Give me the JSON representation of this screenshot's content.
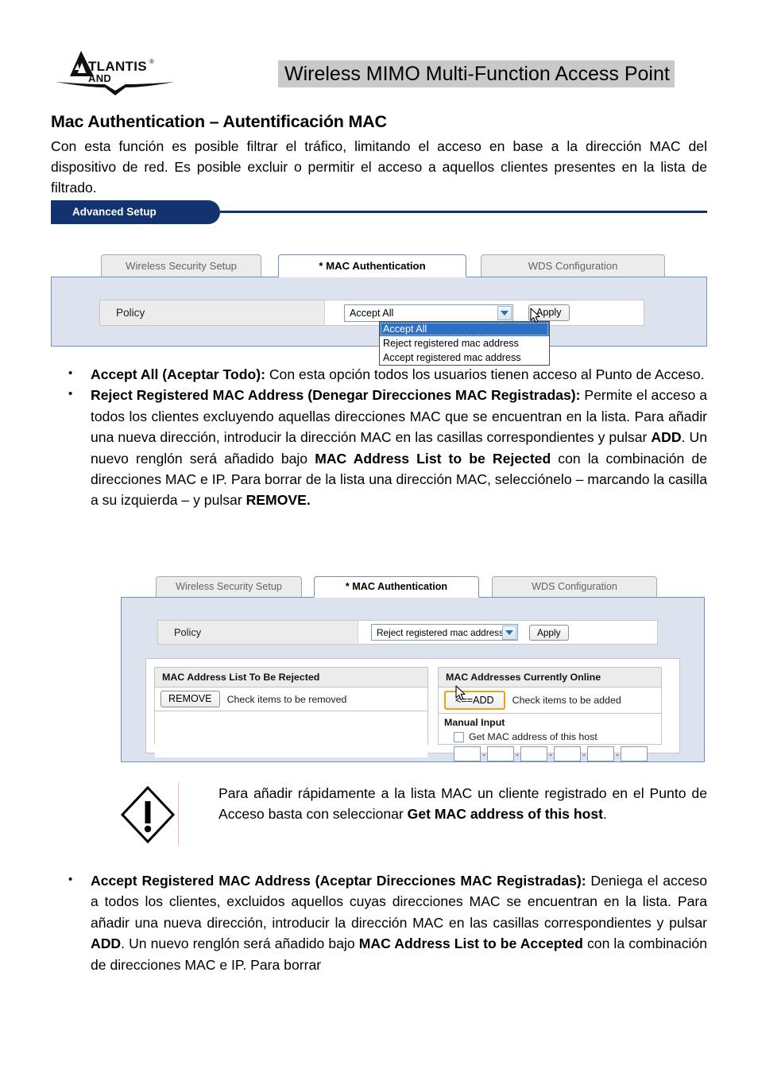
{
  "header": {
    "logo_main": "TLANTIS",
    "logo_reg": "®",
    "logo_sub": "AND",
    "title": "Wireless MIMO Multi-Function Access Point"
  },
  "document": {
    "section_title": "Mac Authentication – Autentificación MAC",
    "intro": "Con esta función es posible filtrar el tráfico, limitando el acceso en base a la dirección MAC del dispositivo de red. Es posible excluir o permitir el acceso a aquellos clientes presentes en la lista de filtrado.",
    "bullets": [
      {
        "lead": "Accept All (Aceptar Todo):",
        "rest": " Con esta opción todos los usuarios tienen acceso al Punto de Acceso."
      },
      {
        "lead": "Reject Registered MAC Address (Denegar Direcciones MAC Registradas):",
        "rest_1": " Permite el acceso a todos los clientes excluyendo aquellas direcciones MAC que se encuentran en la lista. Para añadir una nueva dirección, introducir la dirección MAC en las casillas correspondientes y pulsar ",
        "bold_2": "ADD",
        "rest_2": ". Un nuevo renglón será añadido bajo ",
        "bold_3": "MAC Address List to be Rejected",
        "rest_3": " con la combinación de direcciones MAC e IP. Para borrar de la lista una dirección MAC, selecciónelo – marcando la casilla a su izquierda – y pulsar ",
        "bold_4": "REMOVE."
      },
      {
        "lead": "Accept Registered MAC Address (Aceptar Direcciones MAC Registradas):",
        "rest_1": " Deniega el acceso a todos los clientes, excluidos aquellos cuyas direcciones MAC se encuentran en la lista. Para añadir una nueva dirección, introducir la dirección MAC en las casillas correspondientes y pulsar ",
        "bold_2": "ADD",
        "rest_2": ". Un nuevo renglón será añadido bajo ",
        "bold_3": "MAC Address List to be Accepted",
        "rest_3": " con la combinación de direcciones MAC e IP. Para borrar"
      }
    ]
  },
  "note": {
    "icon": "warning-exclamation-diamond-icon",
    "text_1": "Para añadir rápidamente a la lista MAC un cliente registrado en el Punto de Acceso basta con seleccionar ",
    "bold": "Get MAC address of this host",
    "text_2": "."
  },
  "screenshot1": {
    "banner": "Advanced Setup",
    "tabs": [
      {
        "label": "Wireless Security Setup",
        "active": false
      },
      {
        "label": "* MAC Authentication",
        "active": true
      },
      {
        "label": "WDS Configuration",
        "active": false
      }
    ],
    "policy_label": "Policy",
    "policy_value": "Accept All",
    "apply_label": "Apply",
    "dropdown_options": [
      "Accept All",
      "Reject registered mac address",
      "Accept registered mac address"
    ],
    "dropdown_selected_index": 0
  },
  "screenshot2": {
    "tabs": [
      {
        "label": "Wireless Security Setup",
        "active": false
      },
      {
        "label": "* MAC Authentication",
        "active": true
      },
      {
        "label": "WDS Configuration",
        "active": false
      }
    ],
    "policy_label": "Policy",
    "policy_value": "Reject registered mac address",
    "apply_label": "Apply",
    "left_panel": {
      "header": "MAC Address List To Be Rejected",
      "button": "REMOVE",
      "hint": "Check items to be removed"
    },
    "right_panel": {
      "header": "MAC Addresses Currently Online",
      "button": "<==ADD",
      "hint": "Check items to be added",
      "manual_title": "Manual Input",
      "checkbox_label": "Get MAC address of this host",
      "checkbox_checked": false,
      "mac_octets": [
        "",
        "",
        "",
        "",
        "",
        ""
      ],
      "octet_separator": "-"
    }
  },
  "colors": {
    "banner_navy": "#123370",
    "panel_blue": "#dde3ee",
    "tab_border_blue": "#6f8fc0",
    "tab_inactive_gray": "#ececec",
    "dropdown_highlight": "#2d6ec7",
    "hot_button_orange": "#e8a317",
    "title_highlight_gray": "#c9c9c9"
  }
}
